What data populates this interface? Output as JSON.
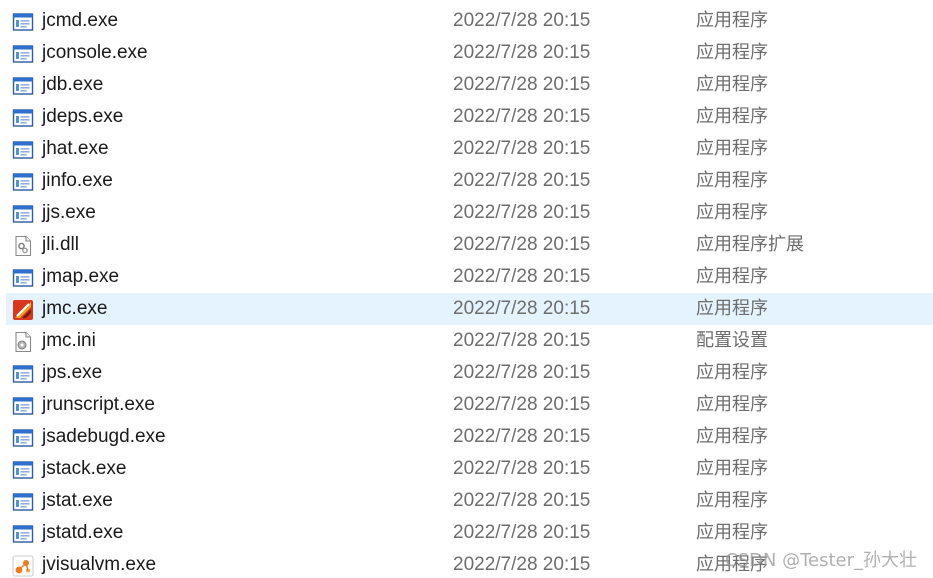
{
  "files": [
    {
      "name": "jcmd.exe",
      "modified": "2022/7/28 20:15",
      "type": "应用程序",
      "icon": "exe"
    },
    {
      "name": "jconsole.exe",
      "modified": "2022/7/28 20:15",
      "type": "应用程序",
      "icon": "exe"
    },
    {
      "name": "jdb.exe",
      "modified": "2022/7/28 20:15",
      "type": "应用程序",
      "icon": "exe"
    },
    {
      "name": "jdeps.exe",
      "modified": "2022/7/28 20:15",
      "type": "应用程序",
      "icon": "exe"
    },
    {
      "name": "jhat.exe",
      "modified": "2022/7/28 20:15",
      "type": "应用程序",
      "icon": "exe"
    },
    {
      "name": "jinfo.exe",
      "modified": "2022/7/28 20:15",
      "type": "应用程序",
      "icon": "exe"
    },
    {
      "name": "jjs.exe",
      "modified": "2022/7/28 20:15",
      "type": "应用程序",
      "icon": "exe"
    },
    {
      "name": "jli.dll",
      "modified": "2022/7/28 20:15",
      "type": "应用程序扩展",
      "icon": "dll"
    },
    {
      "name": "jmap.exe",
      "modified": "2022/7/28 20:15",
      "type": "应用程序",
      "icon": "exe"
    },
    {
      "name": "jmc.exe",
      "modified": "2022/7/28 20:15",
      "type": "应用程序",
      "icon": "jmc",
      "selected": true
    },
    {
      "name": "jmc.ini",
      "modified": "2022/7/28 20:15",
      "type": "配置设置",
      "icon": "ini"
    },
    {
      "name": "jps.exe",
      "modified": "2022/7/28 20:15",
      "type": "应用程序",
      "icon": "exe"
    },
    {
      "name": "jrunscript.exe",
      "modified": "2022/7/28 20:15",
      "type": "应用程序",
      "icon": "exe"
    },
    {
      "name": "jsadebugd.exe",
      "modified": "2022/7/28 20:15",
      "type": "应用程序",
      "icon": "exe"
    },
    {
      "name": "jstack.exe",
      "modified": "2022/7/28 20:15",
      "type": "应用程序",
      "icon": "exe"
    },
    {
      "name": "jstat.exe",
      "modified": "2022/7/28 20:15",
      "type": "应用程序",
      "icon": "exe"
    },
    {
      "name": "jstatd.exe",
      "modified": "2022/7/28 20:15",
      "type": "应用程序",
      "icon": "exe"
    },
    {
      "name": "jvisualvm.exe",
      "modified": "2022/7/28 20:15",
      "type": "应用程序",
      "icon": "jvisualvm"
    }
  ],
  "watermark": "CSDN @Tester_孙大壮",
  "colors": {
    "selected_row": "#e5f3ff",
    "secondary_text": "#6d6d6d",
    "primary_text": "#1a1a1a"
  }
}
